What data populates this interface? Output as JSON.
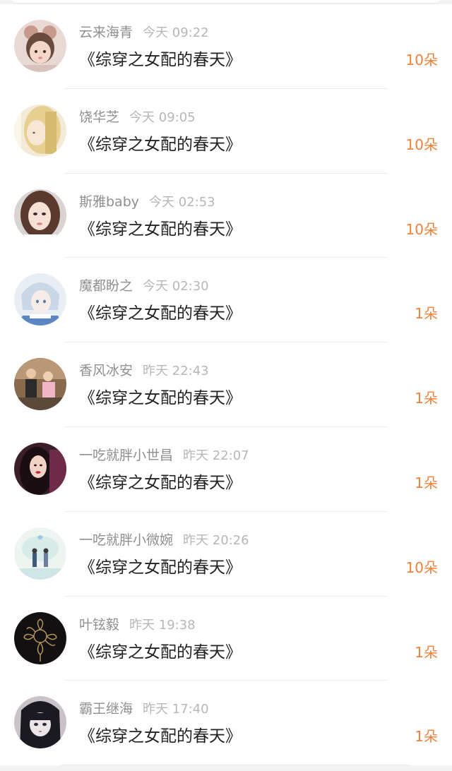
{
  "records": [
    {
      "user": "云来海青",
      "time": "今天 09:22",
      "book": "《综穿之女配的春天》",
      "amount": "10朵",
      "avatar": "girl-headband-avatar"
    },
    {
      "user": "饶华芝",
      "time": "今天 09:05",
      "book": "《综穿之女配的春天》",
      "amount": "10朵",
      "avatar": "blonde-girl-avatar"
    },
    {
      "user": "斯雅baby",
      "time": "今天 02:53",
      "book": "《综穿之女配的春天》",
      "amount": "10朵",
      "avatar": "selfie-girl-avatar"
    },
    {
      "user": "魔都盼之",
      "time": "今天 02:30",
      "book": "《综穿之女配的春天》",
      "amount": "1朵",
      "avatar": "anime-boy-avatar"
    },
    {
      "user": "香风冰安",
      "time": "昨天 22:43",
      "book": "《综穿之女配的春天》",
      "amount": "1朵",
      "avatar": "group-photo-avatar"
    },
    {
      "user": "一吃就胖小世昌",
      "time": "昨天 22:07",
      "book": "《综穿之女配的春天》",
      "amount": "1朵",
      "avatar": "dark-hair-woman-avatar"
    },
    {
      "user": "一吃就胖小微婉",
      "time": "昨天 20:26",
      "book": "《综穿之女配的春天》",
      "amount": "10朵",
      "avatar": "couple-illustration-avatar"
    },
    {
      "user": "叶铉毅",
      "time": "昨天 19:38",
      "book": "《综穿之女配的春天》",
      "amount": "1朵",
      "avatar": "gold-flower-avatar"
    },
    {
      "user": "霸王继海",
      "time": "昨天 17:40",
      "book": "《综穿之女配的春天》",
      "amount": "1朵",
      "avatar": "anime-girl-avatar"
    }
  ],
  "colors": {
    "accent_amount": "#f0813a",
    "username": "#8f8f8f",
    "timestamp": "#b7b7b7",
    "book_title": "#222222"
  }
}
